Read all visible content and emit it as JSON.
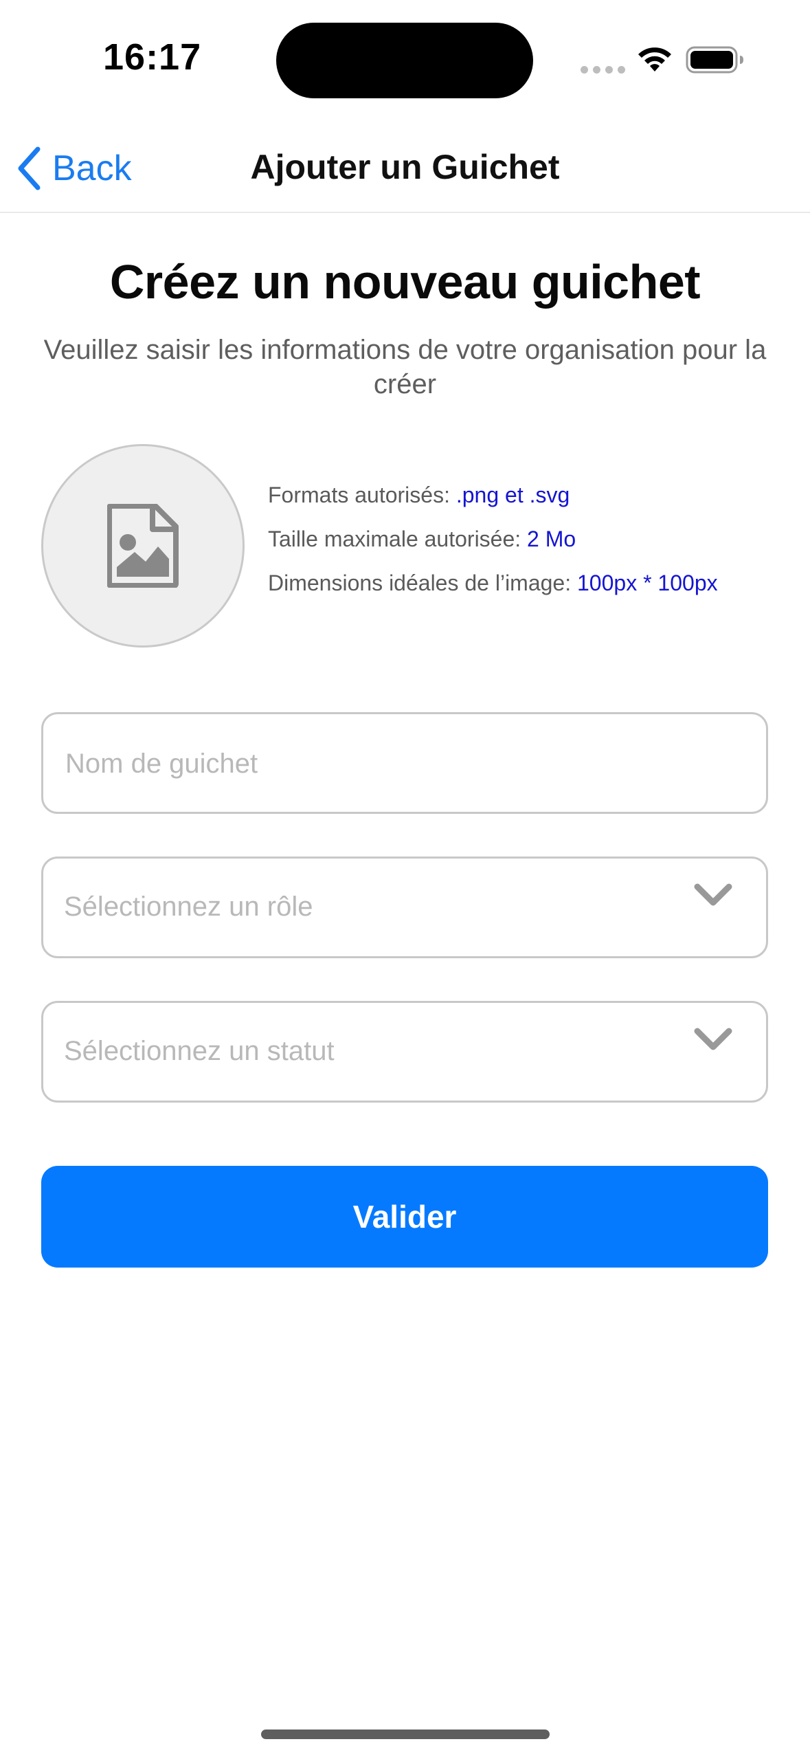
{
  "status_bar": {
    "time": "16:17"
  },
  "nav": {
    "back_label": "Back",
    "title": "Ajouter un Guichet"
  },
  "header": {
    "title": "Créez un nouveau guichet",
    "subtitle": "Veuillez saisir les informations de votre organisation pour la créer"
  },
  "upload": {
    "icon": "image-file-icon",
    "formats_label": "Formats autorisés:",
    "formats_value": ".png et .svg",
    "max_size_label": "Taille maximale autorisée:",
    "max_size_value": "2 Mo",
    "dimensions_label": "Dimensions idéales de l’image:",
    "dimensions_value": "100px * 100px"
  },
  "form": {
    "name_placeholder": "Nom de guichet",
    "role_placeholder": "Sélectionnez un rôle",
    "status_placeholder": "Sélectionnez un statut",
    "submit_label": "Valider"
  },
  "colors": {
    "accent": "#057aff",
    "link": "#1a7cf0",
    "info_value": "#1414d2",
    "placeholder": "#b8b8b8",
    "border": "#c8c8c8"
  }
}
